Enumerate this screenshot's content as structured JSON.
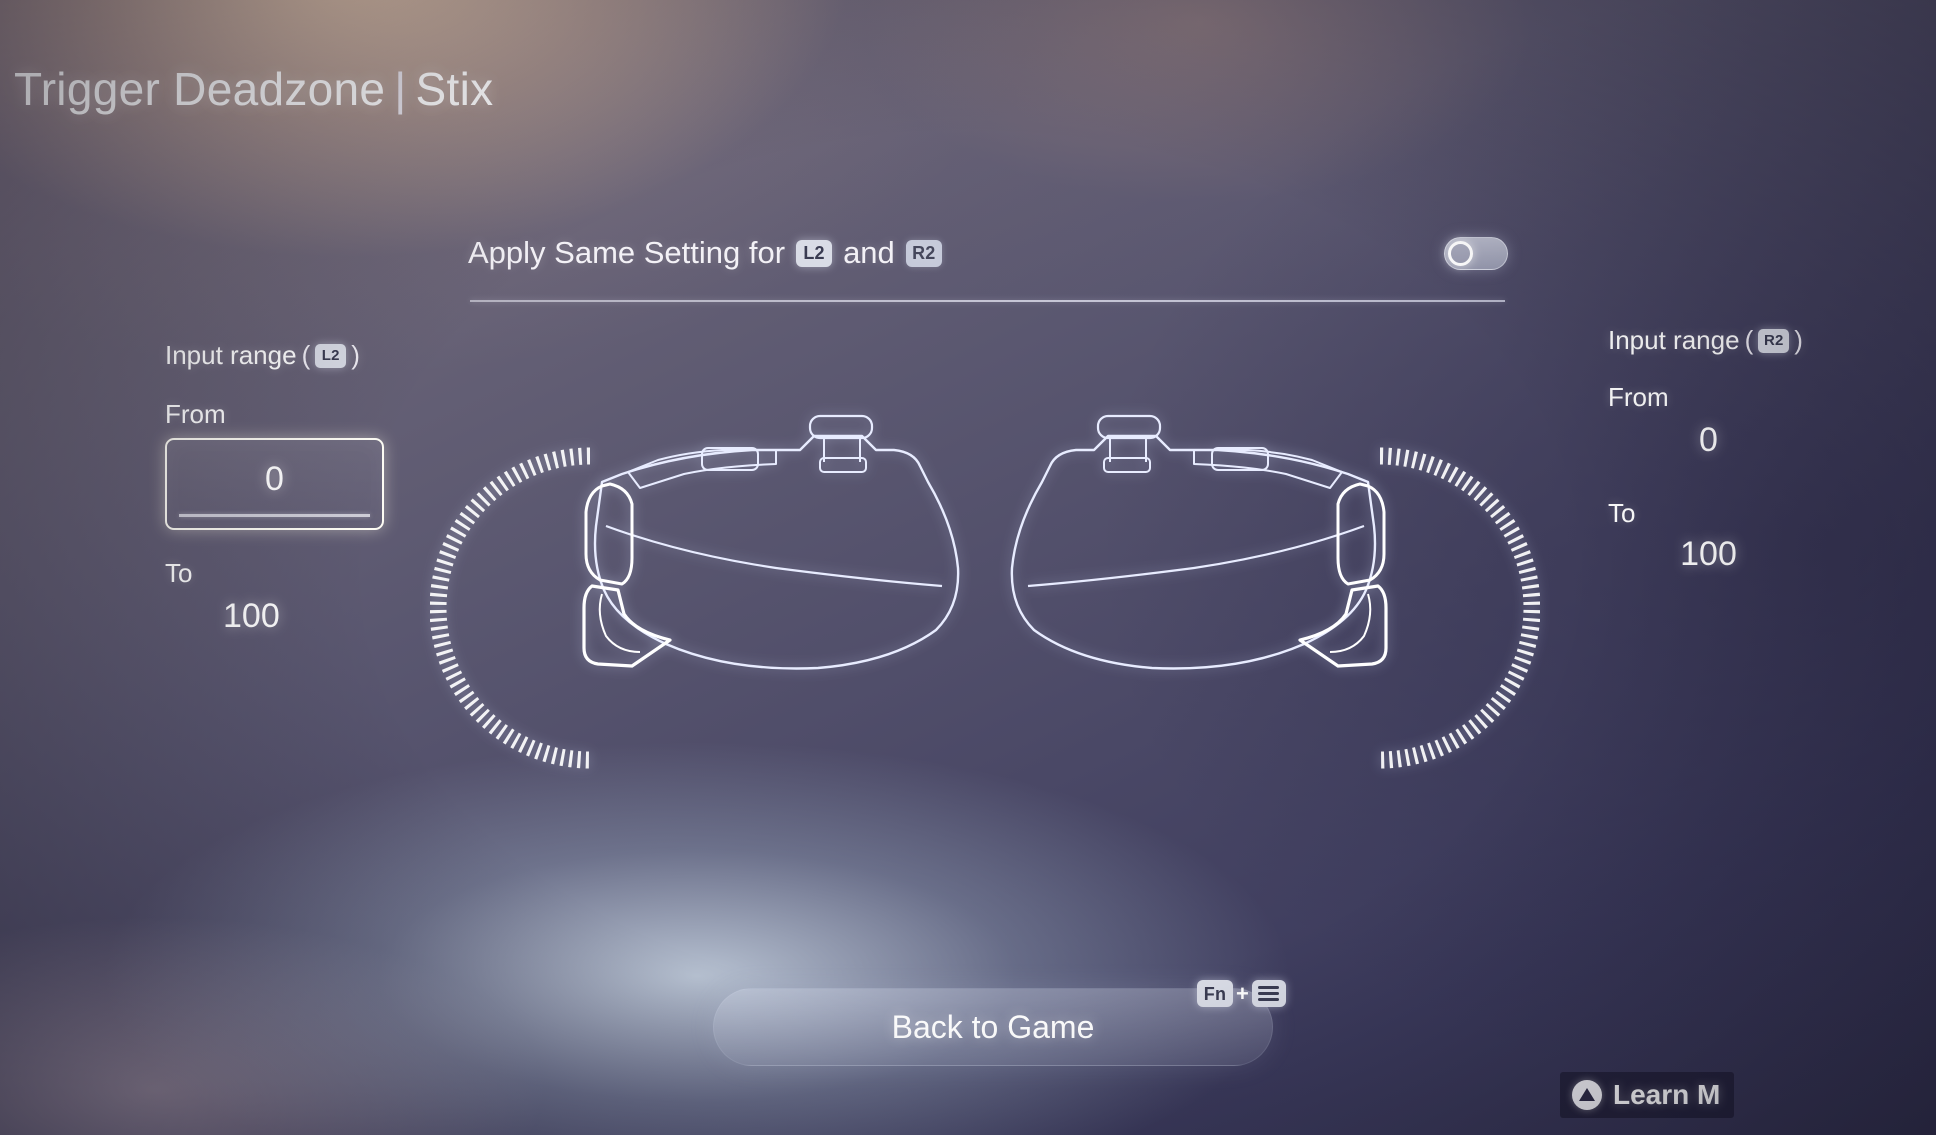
{
  "header": {
    "title_main": "Trigger Deadzone",
    "separator": "|",
    "title_profile": "Stix"
  },
  "apply_same": {
    "label_prefix": "Apply Same Setting for",
    "key_left": "L2",
    "label_conjunction": "and",
    "key_right": "R2",
    "toggle_state": "off"
  },
  "left_panel": {
    "heading_text": "Input range",
    "heading_paren_open": "(",
    "heading_key": "L2",
    "heading_paren_close": ")",
    "from_label": "From",
    "from_value": "0",
    "to_label": "To",
    "to_value": "100"
  },
  "right_panel": {
    "heading_text": "Input range",
    "heading_paren_open": "(",
    "heading_key": "R2",
    "heading_paren_close": ")",
    "from_label": "From",
    "from_value": "0",
    "to_label": "To",
    "to_value": "100"
  },
  "footer": {
    "back_button_label": "Back to Game",
    "hint_key_fn": "Fn",
    "hint_plus": "+",
    "hint_key_menu": "menu-icon",
    "learn_more_label": "Learn M",
    "learn_more_icon": "triangle-button-icon"
  },
  "illustration": {
    "left_controller": "controller-side-profile-left",
    "right_controller": "controller-side-profile-right",
    "left_gauge": "trigger-deadzone-arc-gauge-left",
    "right_gauge": "trigger-deadzone-arc-gauge-right"
  },
  "colors": {
    "text_primary": "#ffffff",
    "keycap_bg": "#d9dce6",
    "keycap_fg": "#3a3c52",
    "focus_border": "#fdfcf4",
    "rule": "#e2e4f0"
  }
}
